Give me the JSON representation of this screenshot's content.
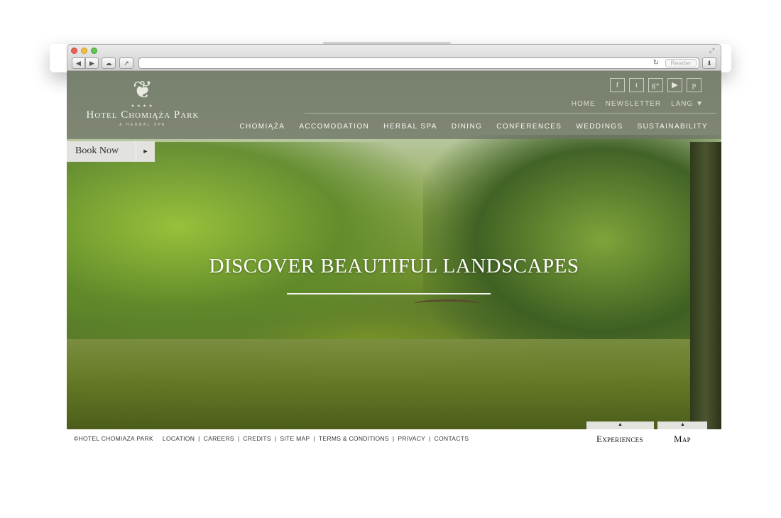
{
  "browser": {
    "reader_label": "Reader"
  },
  "logo": {
    "name": "Hotel Chomiąża Park",
    "sub": "& HERBAL SPA"
  },
  "social": [
    {
      "name": "facebook-icon",
      "glyph": "f"
    },
    {
      "name": "twitter-icon",
      "glyph": "t"
    },
    {
      "name": "google-plus-icon",
      "glyph": "g+"
    },
    {
      "name": "youtube-icon",
      "glyph": "▶"
    },
    {
      "name": "pinterest-icon",
      "glyph": "p"
    }
  ],
  "topnav": {
    "home": "HOME",
    "newsletter": "NEWSLETTER",
    "lang": "LANG ▼"
  },
  "mainnav": [
    "CHOMIĄŻA",
    "ACCOMODATION",
    "HERBAL SPA",
    "DINING",
    "CONFERENCES",
    "WEDDINGS",
    "SUSTAINABILITY"
  ],
  "book_now": {
    "label": "Book Now",
    "arrow": "►"
  },
  "hero": {
    "title": "DISCOVER BEAUTIFUL LANDSCAPES"
  },
  "footer": {
    "copyright": "©HOTEL CHOMIAZA PARK",
    "links": [
      "LOCATION",
      "CAREERS",
      "CREDITS",
      "SITE MAP",
      "TERMS & CONDITIONS",
      "PRIVACY",
      "CONTACTS"
    ]
  },
  "tabs": {
    "experiences": "Experiences",
    "map": "Map",
    "arrow": "▲"
  }
}
